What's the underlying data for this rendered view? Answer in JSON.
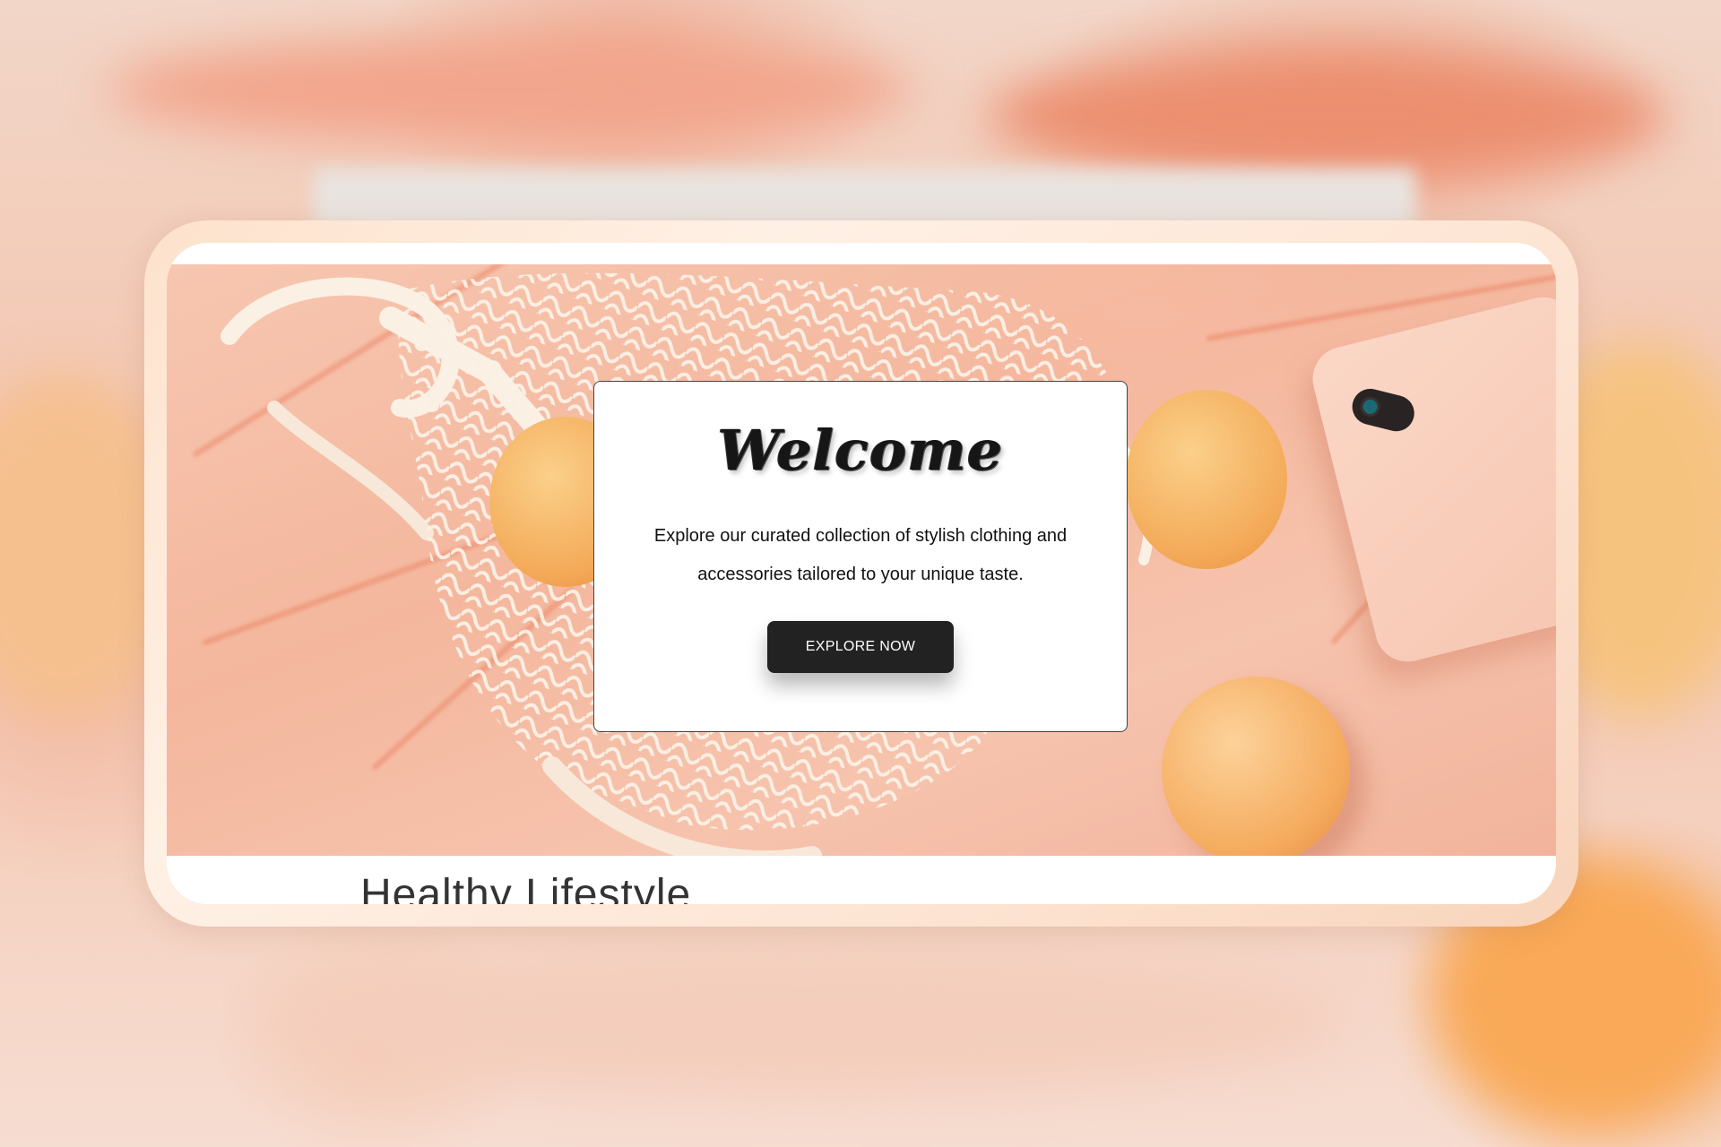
{
  "modal": {
    "title": "Welcome",
    "text": "Explore our curated collection of stylish clothing and accessories tailored to your unique taste.",
    "button_label": "EXPLORE NOW"
  },
  "section": {
    "heading": "Healthy Lifestyle"
  },
  "colors": {
    "accent_peach": "#f4b79d",
    "button_bg": "#222222",
    "frame_glow": "#fde2cc"
  },
  "hero": {
    "image": "mesh-bag-with-peaches-and-phone-on-peach-fabric"
  }
}
